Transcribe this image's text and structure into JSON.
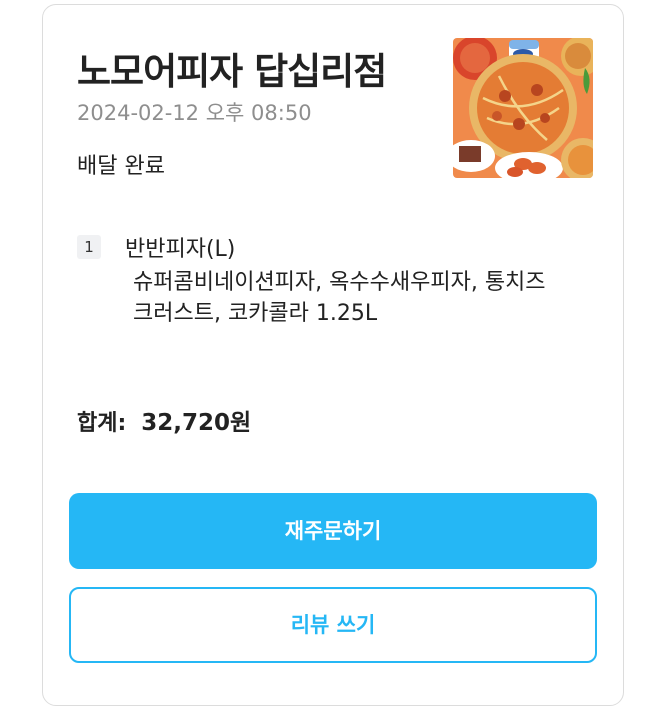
{
  "order": {
    "store_name": "노모어피자 답십리점",
    "date": "2024-02-12 오후 08:50",
    "status": "배달 완료",
    "thumbnail": "pizza-food-photo"
  },
  "items": [
    {
      "quantity": "1",
      "name": "반반피자(L)",
      "options": "슈퍼콤비네이션피자, 옥수수새우피자, 통치즈크러스트, 코카콜라 1.25L"
    }
  ],
  "total": {
    "label": "합계:",
    "amount": "32,720원"
  },
  "buttons": {
    "reorder": "재주문하기",
    "review": "리뷰 쓰기"
  },
  "colors": {
    "accent": "#25b7f5",
    "muted": "#8e8e8e"
  }
}
